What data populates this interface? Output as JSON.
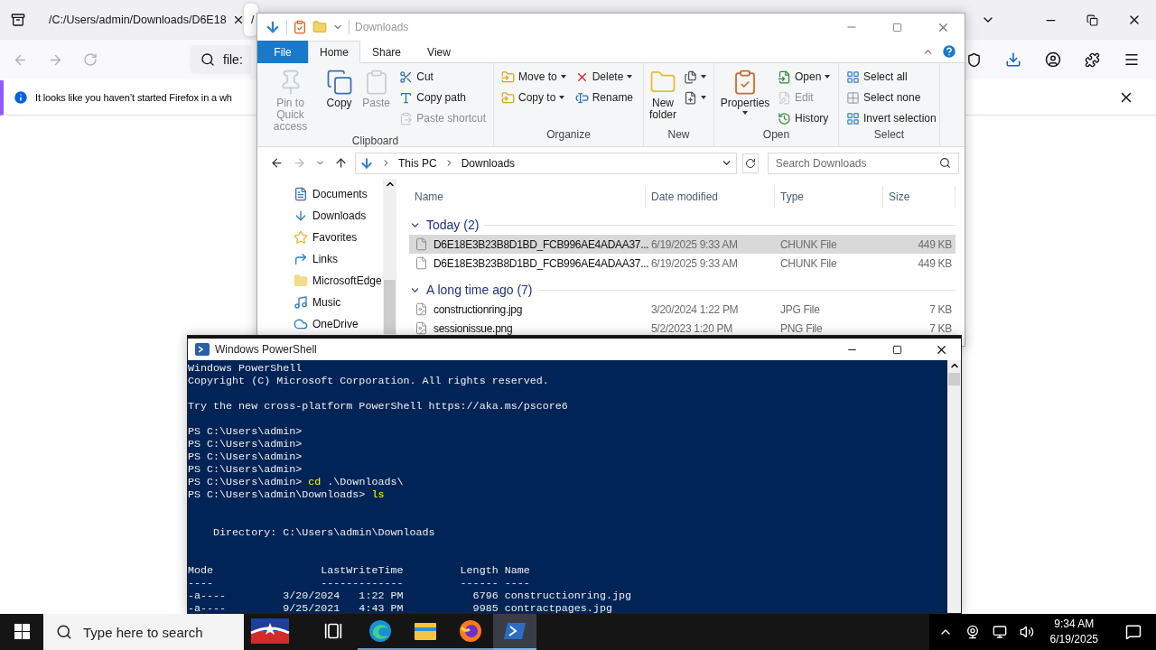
{
  "browser": {
    "tabs": [
      {
        "title": "/C:/Users/admin/Downloads/D6E18",
        "selected": false
      },
      {
        "title": "/",
        "selected": true
      }
    ],
    "address": "file:",
    "notification": "It looks like you haven’t started Firefox in a wh"
  },
  "explorer": {
    "title": "Downloads",
    "ribbon_tabs": [
      {
        "label": "File",
        "kind": "file",
        "selected": false
      },
      {
        "label": "Home",
        "kind": "tab",
        "selected": true
      },
      {
        "label": "Share",
        "kind": "tab",
        "selected": false
      },
      {
        "label": "View",
        "kind": "tab",
        "selected": false
      }
    ],
    "ribbon_groups": [
      {
        "label": "Clipboard",
        "columns": [
          {
            "kind": "large",
            "items": [
              {
                "label": "Pin to Quick access",
                "disabled": true,
                "dropdown": false
              }
            ]
          },
          {
            "kind": "large",
            "items": [
              {
                "label": "Copy",
                "disabled": false,
                "dropdown": false
              }
            ]
          },
          {
            "kind": "large",
            "items": [
              {
                "label": "Paste",
                "disabled": true,
                "dropdown": false
              }
            ]
          },
          {
            "kind": "stack",
            "items": [
              {
                "label": "Cut",
                "disabled": false,
                "dropdown": false
              },
              {
                "label": "Copy path",
                "disabled": false,
                "dropdown": false
              },
              {
                "label": "Paste shortcut",
                "disabled": true,
                "dropdown": false
              }
            ]
          }
        ]
      },
      {
        "label": "Organize",
        "columns": [
          {
            "kind": "stack",
            "items": [
              {
                "label": "Move to",
                "disabled": false,
                "dropdown": true
              },
              {
                "label": "Copy to",
                "disabled": false,
                "dropdown": true
              }
            ]
          },
          {
            "kind": "stack",
            "items": [
              {
                "label": "Delete",
                "disabled": false,
                "dropdown": true
              },
              {
                "label": "Rename",
                "disabled": false,
                "dropdown": false
              }
            ]
          }
        ]
      },
      {
        "label": "New",
        "columns": [
          {
            "kind": "large",
            "items": [
              {
                "label": "New folder",
                "disabled": false,
                "dropdown": false
              }
            ]
          },
          {
            "kind": "stack",
            "items": [
              {
                "disabled": false,
                "dropdown": true
              },
              {
                "disabled": false,
                "dropdown": true
              }
            ]
          }
        ]
      },
      {
        "label": "Open",
        "columns": [
          {
            "kind": "large",
            "items": [
              {
                "label": "Properties",
                "disabled": false,
                "dropdown": true
              }
            ]
          },
          {
            "kind": "stack",
            "items": [
              {
                "label": "Open",
                "disabled": false,
                "dropdown": true
              },
              {
                "label": "Edit",
                "disabled": true,
                "dropdown": false
              },
              {
                "label": "History",
                "disabled": false,
                "dropdown": false
              }
            ]
          }
        ]
      },
      {
        "label": "Select",
        "columns": [
          {
            "kind": "stack",
            "items": [
              {
                "label": "Select all",
                "disabled": false,
                "dropdown": false
              },
              {
                "label": "Select none",
                "disabled": false,
                "dropdown": false
              },
              {
                "label": "Invert selection",
                "disabled": false,
                "dropdown": false
              }
            ]
          }
        ]
      }
    ],
    "path": [
      "This PC",
      "Downloads"
    ],
    "search": {
      "placeholder": "Search Downloads"
    },
    "nav_items": [
      "Documents",
      "Downloads",
      "Favorites",
      "Links",
      "MicrosoftEdge",
      "Music",
      "OneDrive"
    ],
    "columns": [
      "Name",
      "Date modified",
      "Type",
      "Size"
    ],
    "groups": [
      {
        "title": "Today (2)",
        "expanded": true,
        "files": [
          {
            "name": "D6E18E3B23B8D1BD_FCB996AE4ADAA37...",
            "date": "6/19/2025 9:33 AM",
            "type": "CHUNK File",
            "size": "449 KB",
            "kind": "document",
            "selected": true
          },
          {
            "name": "D6E18E3B23B8D1BD_FCB996AE4ADAA37...",
            "date": "6/19/2025 9:33 AM",
            "type": "CHUNK File",
            "size": "449 KB",
            "kind": "document",
            "selected": false
          }
        ]
      },
      {
        "title": "A long time ago (7)",
        "expanded": true,
        "files": [
          {
            "name": "constructionring.jpg",
            "date": "3/20/2024 1:22 PM",
            "type": "JPG File",
            "size": "7 KB",
            "kind": "image",
            "selected": false
          },
          {
            "name": "sessionissue.png",
            "date": "5/2/2023 1:20 PM",
            "type": "PNG File",
            "size": "7 KB",
            "kind": "image",
            "selected": false
          }
        ]
      }
    ]
  },
  "powershell": {
    "title": "Windows PowerShell",
    "lines": [
      {
        "kind": "text",
        "text": "Windows PowerShell"
      },
      {
        "kind": "text",
        "text": "Copyright (C) Microsoft Corporation. All rights reserved."
      },
      {
        "kind": "blank"
      },
      {
        "kind": "text",
        "text": "Try the new cross-platform PowerShell https://aka.ms/pscore6"
      },
      {
        "kind": "blank"
      },
      {
        "kind": "text",
        "text": "PS C:\\Users\\admin>"
      },
      {
        "kind": "text",
        "text": "PS C:\\Users\\admin>"
      },
      {
        "kind": "text",
        "text": "PS C:\\Users\\admin>"
      },
      {
        "kind": "text",
        "text": "PS C:\\Users\\admin>"
      },
      {
        "kind": "prompt",
        "prompt": "PS C:\\Users\\admin> ",
        "command": "cd",
        "args": " .\\Downloads\\"
      },
      {
        "kind": "prompt",
        "prompt": "PS C:\\Users\\admin\\Downloads> ",
        "command": "ls"
      },
      {
        "kind": "blank"
      },
      {
        "kind": "blank"
      },
      {
        "kind": "text",
        "text": "    Directory: C:\\Users\\admin\\Downloads"
      },
      {
        "kind": "blank"
      },
      {
        "kind": "blank"
      },
      {
        "kind": "text",
        "text": "Mode                 LastWriteTime         Length Name"
      },
      {
        "kind": "text",
        "text": "----                 -------------         ------ ----"
      },
      {
        "kind": "text",
        "text": "-a----         3/20/2024   1:22 PM           6796 constructionring.jpg"
      },
      {
        "kind": "text",
        "text": "-a----         9/25/2021   4:43 PM           9985 contractpages.jpg"
      }
    ]
  },
  "taskbar": {
    "search": {
      "placeholder": "Type here to search"
    },
    "apps": [
      {
        "kind": "flag",
        "running": false,
        "active": false
      },
      {
        "kind": "taskview",
        "running": false,
        "active": false
      },
      {
        "kind": "edge",
        "running": true,
        "active": false
      },
      {
        "kind": "explorer",
        "running": true,
        "active": false
      },
      {
        "kind": "firefox",
        "running": true,
        "active": false
      },
      {
        "kind": "powershell",
        "running": true,
        "active": true
      }
    ],
    "time": "9:34 AM",
    "date": "6/19/2025"
  }
}
